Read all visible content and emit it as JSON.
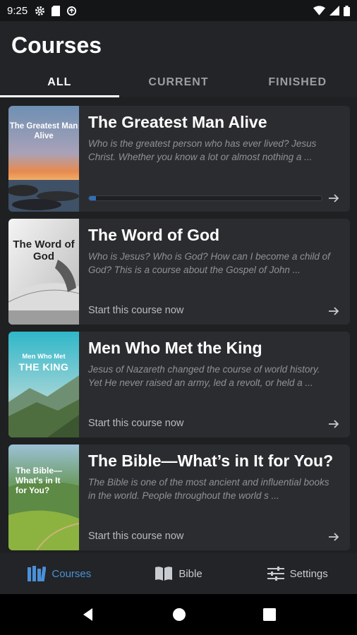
{
  "status_bar": {
    "time": "9:25"
  },
  "page": {
    "title": "Courses"
  },
  "tabs": [
    {
      "label": "ALL",
      "active": true
    },
    {
      "label": "CURRENT",
      "active": false
    },
    {
      "label": "FINISHED",
      "active": false
    }
  ],
  "courses": [
    {
      "title": "The Greatest Man Alive",
      "description": "Who is the greatest person who has ever lived? Jesus Christ. Whether you know a lot or almost nothing a ...",
      "thumb_text": "The Greatest Man Alive",
      "progress": 0.03,
      "cta": ""
    },
    {
      "title": "The Word of God",
      "description": "Who is Jesus? Who is God? How can I become a child of God? This is a course about the Gospel of John ...",
      "thumb_text": "The Word of God",
      "cta": "Start this course now"
    },
    {
      "title": "Men Who Met the King",
      "description": "Jesus of Nazareth changed the course of world history. Yet He never raised an army, led a revolt, or held a ...",
      "thumb_text_small": "Men Who Met",
      "thumb_text_big": "THE KING",
      "cta": "Start this course now"
    },
    {
      "title": "The Bible—What’s in It for You?",
      "description": "The Bible is one of the most ancient and influential books in the world. People throughout the world s ...",
      "thumb_text": "The Bible— What's in It for You?",
      "cta": "Start this course now"
    }
  ],
  "bottom_nav": [
    {
      "label": "Courses",
      "icon": "books-icon",
      "active": true
    },
    {
      "label": "Bible",
      "icon": "open-book-icon",
      "active": false
    },
    {
      "label": "Settings",
      "icon": "sliders-icon",
      "active": false
    }
  ],
  "colors": {
    "accent": "#4a90d9",
    "background": "#1f2022",
    "card": "#2b2c2f"
  }
}
